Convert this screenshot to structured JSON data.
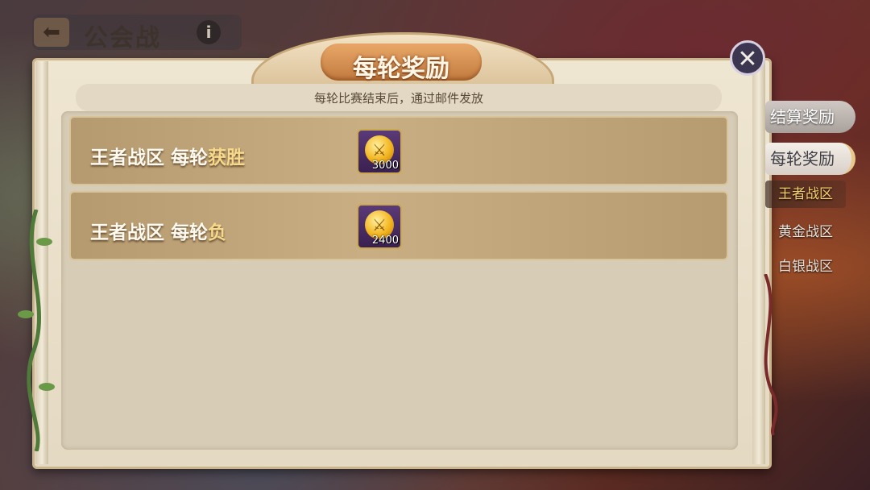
{
  "header": {
    "back_icon": "back-arrow-icon",
    "title": "公会战",
    "info_icon": "info-icon"
  },
  "dialog": {
    "title": "每轮奖励",
    "subtitle": "每轮比赛结束后，通过邮件发放",
    "close_icon": "close-icon",
    "rows": [
      {
        "label_prefix": "王者战区 每轮",
        "label_result": "获胜",
        "item_icon": "gold-coin-icon",
        "quantity": "3000"
      },
      {
        "label_prefix": "王者战区 每轮",
        "label_result": "负",
        "item_icon": "gold-coin-icon",
        "quantity": "2400"
      }
    ]
  },
  "side_nav": {
    "tabs": [
      {
        "label": "结算奖励",
        "active": false
      },
      {
        "label": "每轮奖励",
        "active": true
      }
    ],
    "sub_tabs": [
      {
        "label": "王者战区",
        "active": true
      },
      {
        "label": "黄金战区",
        "active": false
      },
      {
        "label": "白银战区",
        "active": false
      }
    ]
  },
  "colors": {
    "highlight": "#f6d98a",
    "active_subtab": "#f6d06a",
    "item_frame": "#5b3a78"
  }
}
